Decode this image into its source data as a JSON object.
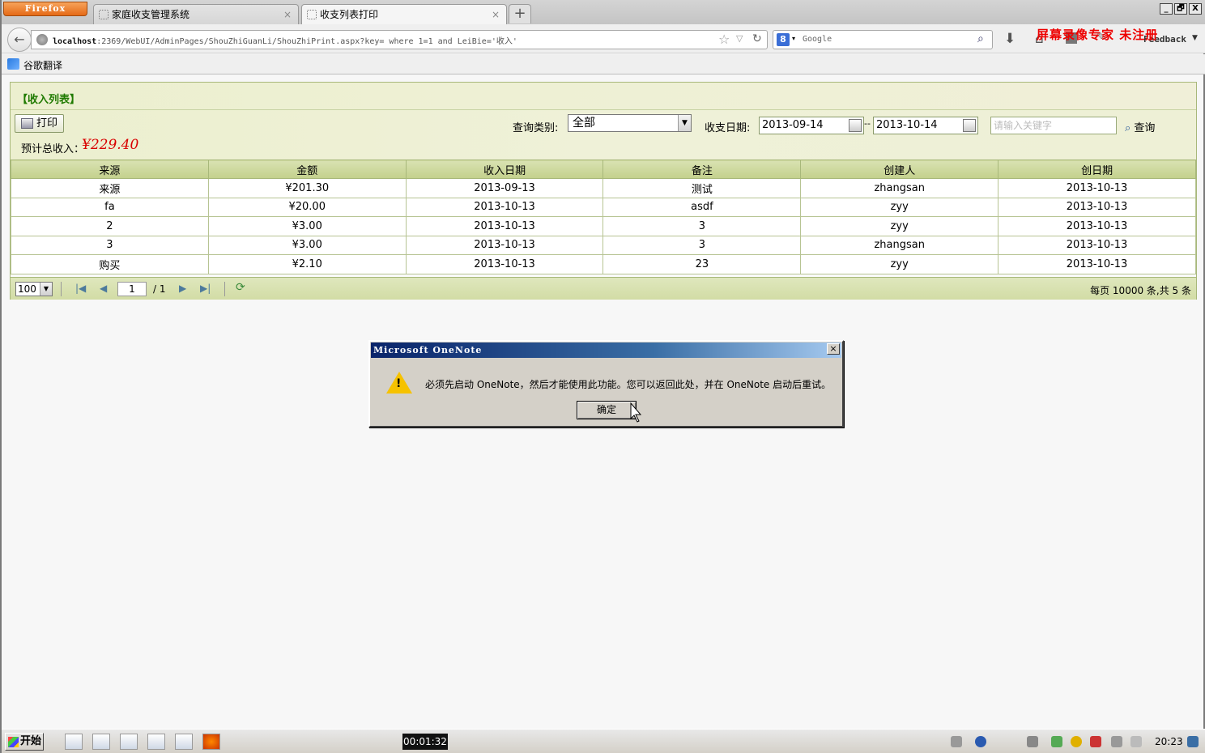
{
  "browser": {
    "app_button": "Firefox",
    "tabs": [
      {
        "label": "家庭收支管理系统",
        "active": false
      },
      {
        "label": "收支列表打印",
        "active": true
      }
    ],
    "new_tab": "+",
    "url_host": "localhost",
    "url_rest": ":2369/WebUI/AdminPages/ShouZhiGuanLi/ShouZhiPrint.aspx?key= where 1=1 and LeiBie='收入'",
    "search_engine_icon": "8",
    "search_placeholder": "Google",
    "feedback": "Feedback",
    "watermark": "屏幕录像专家 未注册",
    "bookmark": "谷歌翻译",
    "window_buttons": [
      "_",
      "🗗",
      "X"
    ]
  },
  "page": {
    "panel_title": "【收入列表】",
    "print_button": "打印",
    "total_label": "预计总收入：",
    "total_value": "¥229.40",
    "query_type_label": "查询类别:",
    "query_type_value": "全部",
    "date_label": "收支日期:",
    "date_from": "2013-09-14",
    "date_sep": "--",
    "date_to": "2013-10-14",
    "keyword_placeholder": "请输入关键字",
    "search_button": "查询",
    "columns": [
      "来源",
      "金额",
      "收入日期",
      "备注",
      "创建人",
      "创日期"
    ],
    "rows": [
      [
        "来源",
        "¥201.30",
        "2013-09-13",
        "测试",
        "zhangsan",
        "2013-10-13"
      ],
      [
        "fa",
        "¥20.00",
        "2013-10-13",
        "asdf",
        "zyy",
        "2013-10-13"
      ],
      [
        "2",
        "¥3.00",
        "2013-10-13",
        "3",
        "zyy",
        "2013-10-13"
      ],
      [
        "3",
        "¥3.00",
        "2013-10-13",
        "3",
        "zhangsan",
        "2013-10-13"
      ],
      [
        "购买",
        "¥2.10",
        "2013-10-13",
        "23",
        "zyy",
        "2013-10-13"
      ]
    ],
    "pager": {
      "page_size": "100",
      "current_page": "1",
      "total_pages": "/ 1",
      "info": "每页 10000 条,共 5 条"
    }
  },
  "dialog": {
    "title": "Microsoft OneNote",
    "message": "必须先启动 OneNote，然后才能使用此功能。您可以返回此处，并在 OneNote 启动后重试。",
    "ok_button": "确定",
    "close": "×"
  },
  "taskbar": {
    "start": "开始",
    "timer": "00:01:32",
    "clock": "20:23"
  }
}
